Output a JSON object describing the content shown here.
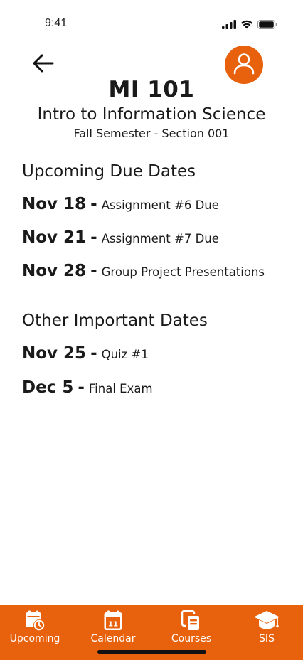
{
  "status_bar": {
    "time": "9:41",
    "icons": [
      "signal-icon",
      "wifi-icon",
      "battery-icon"
    ]
  },
  "header": {
    "back_icon": "arrow-left-icon",
    "avatar_icon": "user-icon",
    "course_code": "MI 101",
    "course_title": "Intro to Information Science",
    "course_section": "Fall Semester - Section 001"
  },
  "upcoming": {
    "heading": "Upcoming Due Dates",
    "items": [
      {
        "date": "Nov 18",
        "sep": "-",
        "desc": "Assignment #6 Due"
      },
      {
        "date": "Nov 21",
        "sep": "-",
        "desc": "Assignment #7 Due"
      },
      {
        "date": "Nov 28",
        "sep": "-",
        "desc": "Group Project Presentations"
      }
    ]
  },
  "important": {
    "heading": "Other Important Dates",
    "items": [
      {
        "date": "Nov 25",
        "sep": "-",
        "desc": "Quiz #1"
      },
      {
        "date": "Dec 5",
        "sep": "-",
        "desc": "Final Exam"
      }
    ]
  },
  "bottom_nav": {
    "items": [
      {
        "label": "Upcoming",
        "icon": "calendar-clock-icon"
      },
      {
        "label": "Calendar",
        "icon": "calendar-icon"
      },
      {
        "label": "Courses",
        "icon": "courses-stack-icon"
      },
      {
        "label": "SIS",
        "icon": "graduation-cap-icon"
      }
    ],
    "calendar_day": "11"
  },
  "colors": {
    "accent": "#E8610C",
    "text": "#1A1A1A",
    "background": "#FFFFFF"
  }
}
